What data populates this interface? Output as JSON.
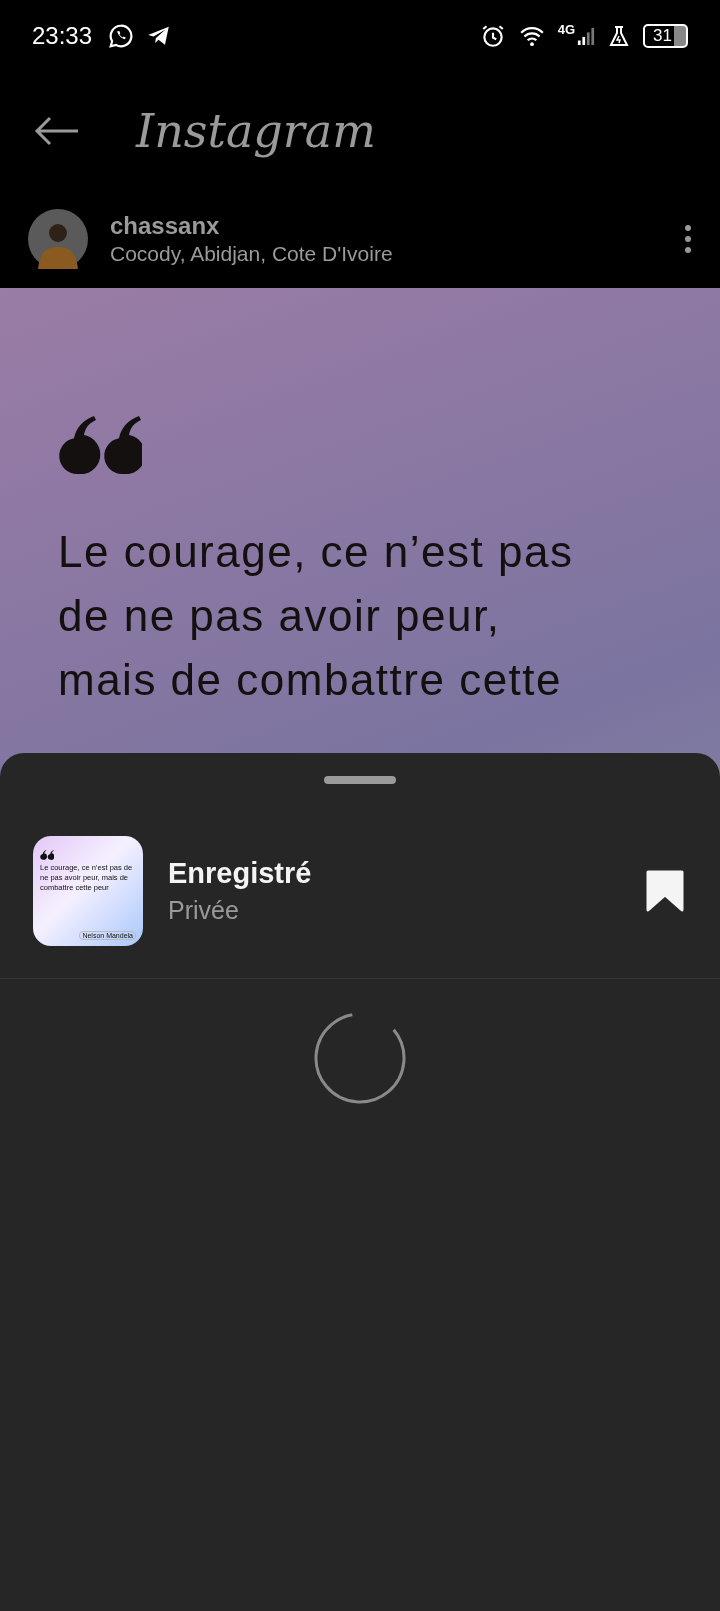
{
  "status_bar": {
    "time": "23:33",
    "network": "4G",
    "battery": "31"
  },
  "header": {
    "title": "Instagram"
  },
  "post": {
    "username": "chassanx",
    "location": "Cocody, Abidjan, Cote D'Ivoire",
    "quote_lines": [
      "Le courage, ce n’est pas",
      "de ne pas avoir peur,",
      "mais de combattre cette"
    ]
  },
  "sheet": {
    "collections": [
      {
        "title": "Enregistré",
        "subtitle": "Privée",
        "saved": true,
        "thumbnail": {
          "quote": "Le courage, ce n’est pas de ne pas avoir peur, mais de combattre cette peur",
          "author": "Nelson Mandela"
        }
      }
    ],
    "loading": true
  }
}
